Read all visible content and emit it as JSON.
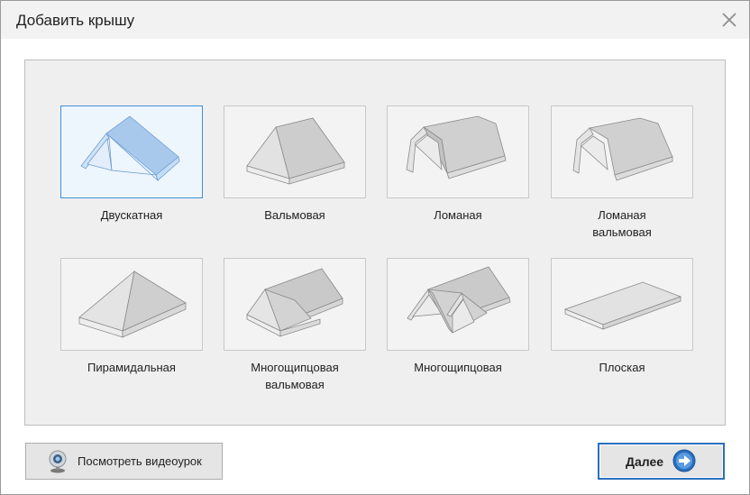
{
  "window": {
    "title": "Добавить крышу"
  },
  "roof_types": [
    {
      "line1": "Двускатная",
      "line2": ""
    },
    {
      "line1": "Вальмовая",
      "line2": ""
    },
    {
      "line1": "Ломаная",
      "line2": ""
    },
    {
      "line1": "Ломаная",
      "line2": "вальмовая"
    },
    {
      "line1": "Пирамидальная",
      "line2": ""
    },
    {
      "line1": "Многощипцовая",
      "line2": "вальмовая"
    },
    {
      "line1": "Многощипцовая",
      "line2": ""
    },
    {
      "line1": "Плоская",
      "line2": ""
    }
  ],
  "selected_roof": "Двускатная",
  "buttons": {
    "video": "Посмотреть видеоурок",
    "next": "Далее"
  },
  "colors": {
    "accent": "#2a6fbf",
    "selection_border": "#3f8fd2",
    "selection_fill": "#eef6fd"
  }
}
